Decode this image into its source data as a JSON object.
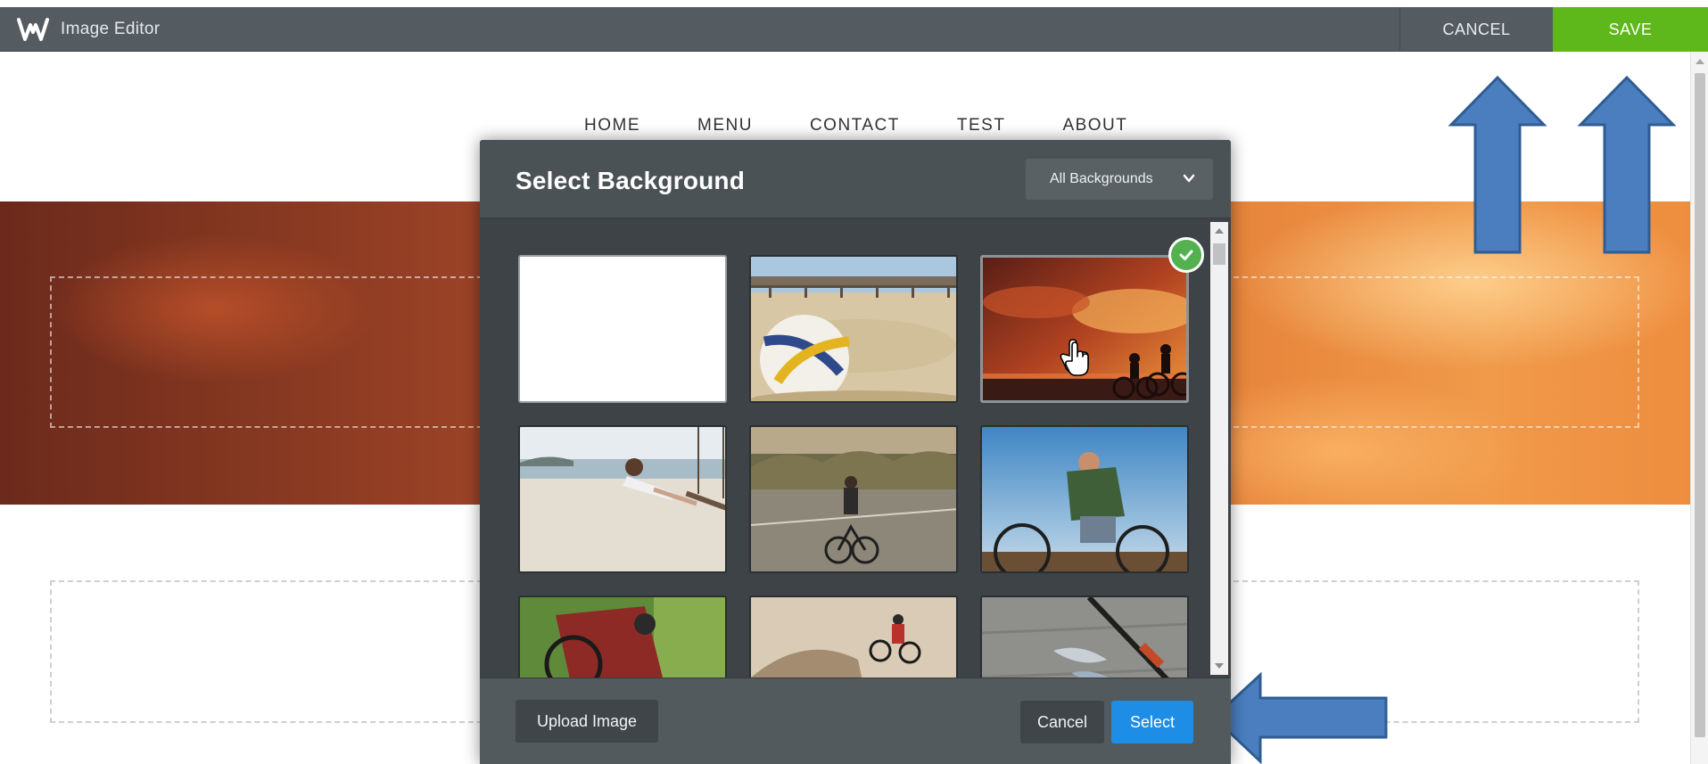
{
  "editor_bar": {
    "logo_icon": "weebly-w-icon",
    "title": "Image Editor",
    "cancel_label": "CANCEL",
    "save_label": "SAVE",
    "save_color": "#5fb81b"
  },
  "site_nav": {
    "items": [
      "HOME",
      "MENU",
      "CONTACT",
      "TEST",
      "ABOUT"
    ]
  },
  "modal": {
    "title": "Select Background",
    "filter_selected": "All Backgrounds",
    "tiles": [
      {
        "image": "plain-white",
        "selected": false
      },
      {
        "image": "volleyball-on-beach",
        "selected": false
      },
      {
        "image": "cyclists-at-sunset",
        "selected": true
      },
      {
        "image": "woman-on-beach-swing",
        "selected": false
      },
      {
        "image": "cyclist-on-road",
        "selected": false
      },
      {
        "image": "cyclist-with-backpack",
        "selected": false
      },
      {
        "image": "mountain-biker-closeup",
        "selected": false
      },
      {
        "image": "bmx-rider-jump",
        "selected": false
      },
      {
        "image": "fishing-rod-and-lure",
        "selected": false
      }
    ],
    "upload_label": "Upload Image",
    "cancel_label": "Cancel",
    "select_label": "Select",
    "select_color": "#1d8de5"
  }
}
